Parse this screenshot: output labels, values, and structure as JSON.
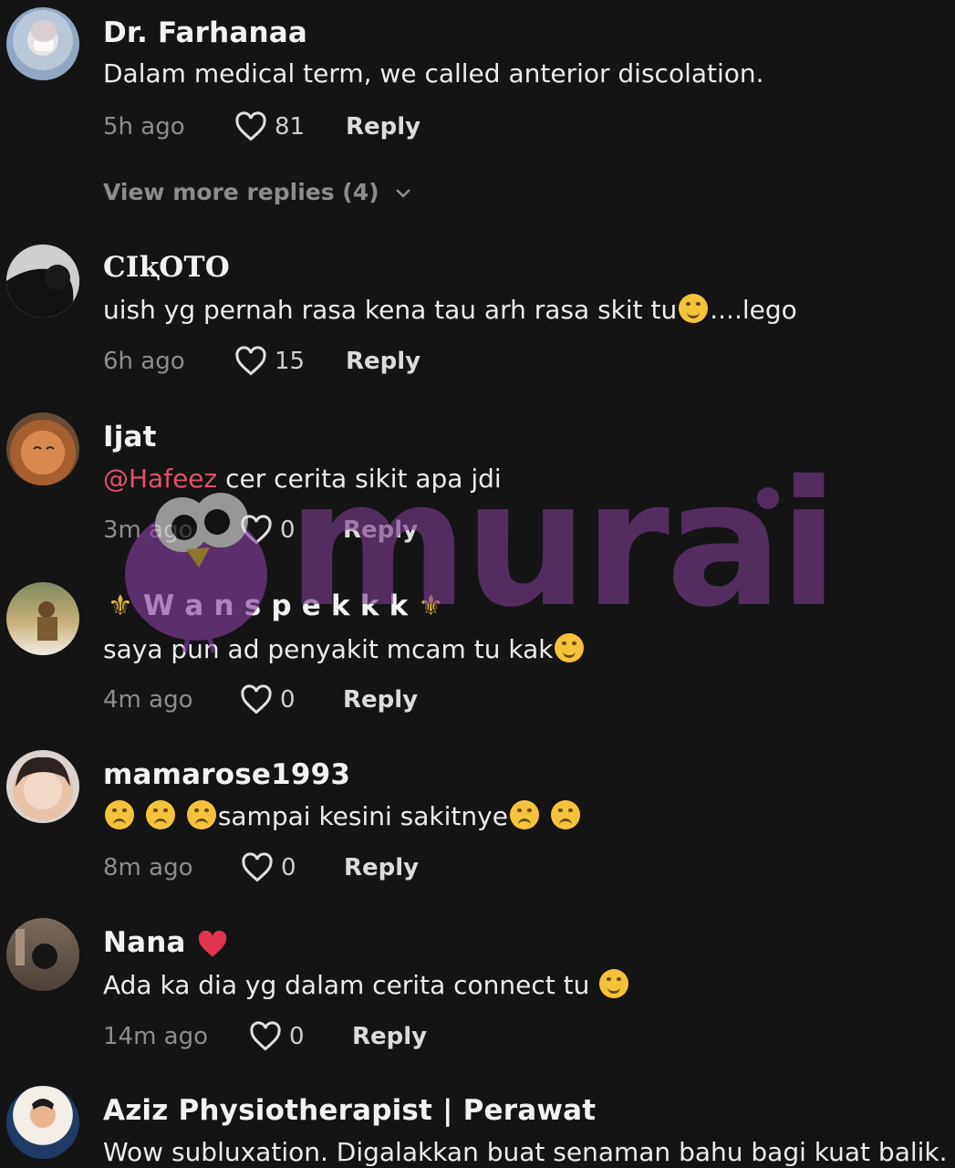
{
  "comments": [
    {
      "username": "Dr. Farhanaa",
      "text": "Dalam medical term, we called anterior discolation.",
      "time": "5h ago",
      "likes": "81",
      "reply_label": "Reply",
      "view_more": "View more replies (4)"
    },
    {
      "username": "CIⱪOTO",
      "text": "uish yg pernah rasa kena tau arh rasa skit tu",
      "text_suffix": "....lego",
      "time": "6h ago",
      "likes": "15",
      "reply_label": "Reply"
    },
    {
      "username": "Ijat",
      "mention": "@Hafeez",
      "text": " cer cerita sikit apa jdi",
      "time": "3m ago",
      "likes": "0",
      "reply_label": "Reply"
    },
    {
      "username": "W a n s p e k k k",
      "text": "saya pun ad penyakit mcam tu kak",
      "time": "4m ago",
      "likes": "0",
      "reply_label": "Reply"
    },
    {
      "username": "mamarose1993",
      "text": "sampai kesini sakitnye",
      "time": "8m ago",
      "likes": "0",
      "reply_label": "Reply"
    },
    {
      "username": "Nana",
      "text": "Ada ka dia yg dalam cerita connect tu",
      "time": "14m ago",
      "likes": "0",
      "reply_label": "Reply"
    },
    {
      "username": "Aziz Physiotherapist | Perawat",
      "text": "Wow subluxation. Digalakkan buat senaman bahu bagi kuat balik."
    }
  ],
  "watermark": {
    "text": "murai"
  },
  "colors": {
    "background": "#141414",
    "mention": "#e0526a",
    "watermark": "#7b3d8f"
  },
  "icons": [
    "heart-outline-icon",
    "chevron-down-icon",
    "laughing-emoji-icon",
    "pensive-emoji-icon",
    "frowning-emoji-icon",
    "red-heart-icon",
    "fleur-de-lis-icon"
  ]
}
